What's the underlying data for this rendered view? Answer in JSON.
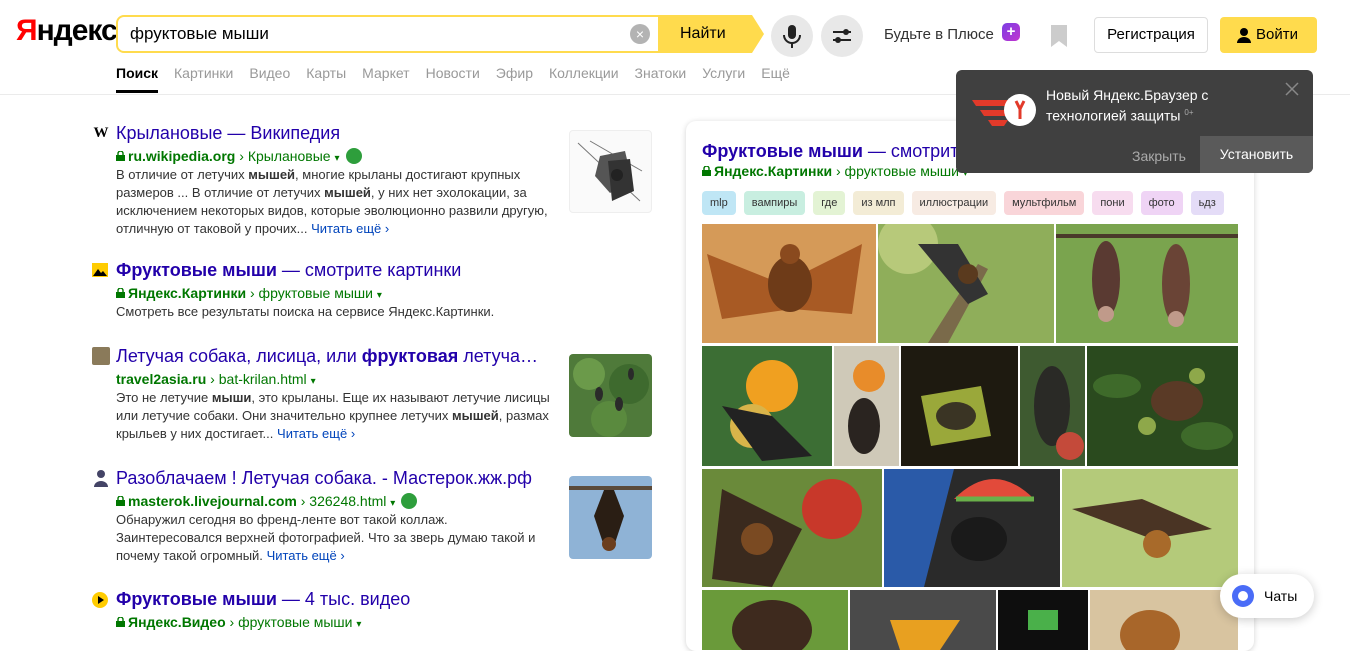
{
  "header": {
    "logo": {
      "part1": "Я",
      "part2": "ндекс"
    },
    "search_value": "фруктовые мыши",
    "find_label": "Найти",
    "plus_text": "Будьте в Плюсе",
    "register_label": "Регистрация",
    "login_label": "Войти",
    "tabs": [
      {
        "label": "Поиск"
      },
      {
        "label": "Картинки"
      },
      {
        "label": "Видео"
      },
      {
        "label": "Карты"
      },
      {
        "label": "Маркет"
      },
      {
        "label": "Новости"
      },
      {
        "label": "Эфир"
      },
      {
        "label": "Коллекции"
      },
      {
        "label": "Знатоки"
      },
      {
        "label": "Услуги"
      },
      {
        "label": "Ещё"
      }
    ]
  },
  "results": [
    {
      "title": "Крылановые — Википедия",
      "domain": "ru.wikipedia.org",
      "path": "Крылановые",
      "snippet_parts": [
        "В отличие от летучих ",
        "мышей",
        ", многие крыланы достигают крупных размеров ... В отличие от летучих ",
        "мышей",
        ", у них нет эхолокации, за исключением некоторых видов, которые эволюционно развили другую, отличную от таковой у прочих..."
      ],
      "more": "Читать ещё ›"
    },
    {
      "title_bold": "Фруктовые мыши",
      "title_rest": " — смотрите картинки",
      "domain": "Яндекс.Картинки",
      "path": "фруктовые мыши",
      "snippet": "Смотреть все результаты поиска на сервисе Яндекс.Картинки."
    },
    {
      "title_a": "Летучая собака, лисица, или ",
      "title_bold": "фруктовая",
      "title_b": " летуча…",
      "domain": "travel2asia.ru",
      "path": "bat-krilan.html",
      "snippet_parts": [
        "Это не летучие ",
        "мыши",
        ", это крыланы. Еще их называют летучие лисицы или летучие собаки. Они значительно крупнее летучих ",
        "мышей",
        ", размах крыльев у них достигает..."
      ],
      "more": "Читать ещё ›"
    },
    {
      "title": "Разоблачаем ! Летучая собака. - Мастерок.жж.рф",
      "domain": "masterok.livejournal.com",
      "path": "326248.html",
      "snippet": "Обнаружил сегодня во френд-ленте вот такой коллаж. Заинтересовался верхней фотографией. Что за зверь думаю такой и почему такой огромный.",
      "more": "Читать ещё ›"
    },
    {
      "title_bold": "Фруктовые мыши",
      "title_rest": " — 4 тыс. видео",
      "domain": "Яндекс.Видео",
      "path": "фруктовые мыши"
    }
  ],
  "images_card": {
    "title_bold": "Фруктовые мыши",
    "title_rest": " — смотрит",
    "domain": "Яндекс.Картинки",
    "path": "фруктовые мыши",
    "chips": [
      {
        "label": "mlp",
        "color": "#bfe6f5"
      },
      {
        "label": "вампиры",
        "color": "#c8eee0"
      },
      {
        "label": "где",
        "color": "#e3f3d4"
      },
      {
        "label": "из млп",
        "color": "#f3ecd6"
      },
      {
        "label": "иллюстрации",
        "color": "#f7ebe3"
      },
      {
        "label": "мультфильм",
        "color": "#f9d5d9"
      },
      {
        "label": "пони",
        "color": "#f7dcef"
      },
      {
        "label": "фото",
        "color": "#efd4f5"
      },
      {
        "label": "ьдз",
        "color": "#e4dcf7"
      }
    ]
  },
  "popup": {
    "text": "Новый Яндекс.Браузер с технологией защиты",
    "age": "0+",
    "close_label": "Закрыть",
    "install_label": "Установить"
  },
  "chats_label": "Чаты",
  "colors": {
    "accent": "#ffdb4d",
    "link": "#2200aa",
    "url_green": "#007700"
  }
}
